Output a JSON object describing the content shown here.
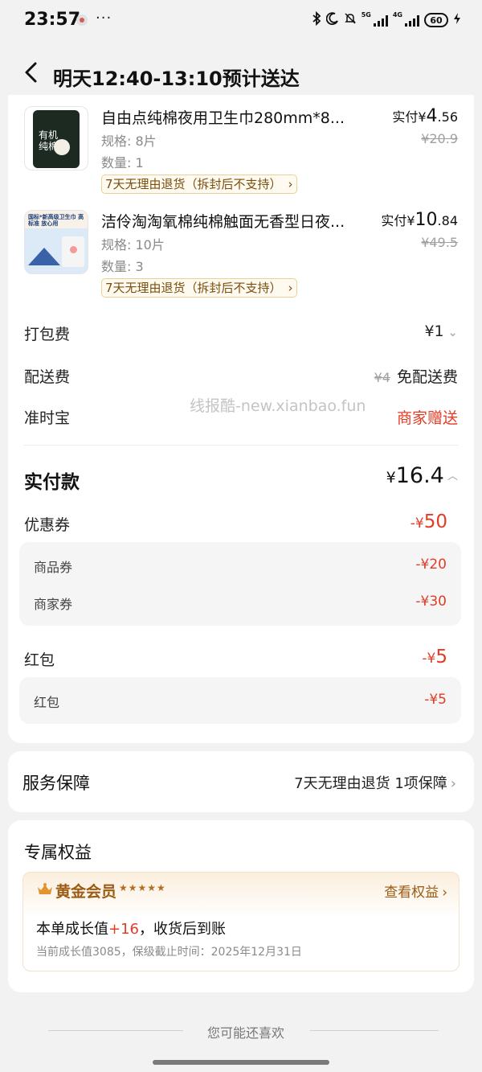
{
  "status_bar": {
    "time": "23:57",
    "more": "···",
    "network_label": "5G",
    "network_label2": "4G",
    "battery": "60"
  },
  "nav": {
    "title": "明天12:40-13:10预计送达"
  },
  "products": [
    {
      "thumb_text": "有机纯棉",
      "title": "自由点纯棉夜用卫生巾280mm*8...",
      "spec": "规格: 8片",
      "qty": "数量: 1",
      "return_tag": "7天无理由退货（拆封后不支持）",
      "paid_label": "实付",
      "paid_yen": "¥",
      "paid_int": "4",
      "paid_dec": ".56",
      "orig_price": "¥20.9"
    },
    {
      "thumb_text": "国标*新高级卫生巾 高标准 放心用",
      "title": "洁伶淘淘氧棉纯棉触面无香型日夜...",
      "spec": "规格: 10片",
      "qty": "数量: 3",
      "return_tag": "7天无理由退货（拆封后不支持）",
      "paid_label": "实付",
      "paid_yen": "¥",
      "paid_int": "10",
      "paid_dec": ".84",
      "orig_price": "¥49.5"
    }
  ],
  "fees": {
    "packing_label": "打包费",
    "packing_value": "¥1",
    "delivery_label": "配送费",
    "delivery_orig": "¥4",
    "delivery_value": "免配送费",
    "ontime_label": "准时宝",
    "ontime_value": "商家赠送"
  },
  "watermark": "线报酷-new.xianbao.fun",
  "total": {
    "label": "实付款",
    "yen": "¥",
    "value": "16.4"
  },
  "coupons": {
    "label": "优惠券",
    "yen": "-¥",
    "value": "50",
    "items": [
      {
        "label": "商品券",
        "value": "-¥20"
      },
      {
        "label": "商家券",
        "value": "-¥30"
      }
    ]
  },
  "red_packet": {
    "label": "红包",
    "yen": "-¥",
    "value": "5",
    "items": [
      {
        "label": "红包",
        "value": "-¥5"
      }
    ]
  },
  "service": {
    "label": "服务保障",
    "value": "7天无理由退货 1项保障"
  },
  "benefits": {
    "title": "专属权益",
    "vip_name": "黄金会员",
    "vip_stars": "★★★★★",
    "link": "查看权益",
    "main_prefix": "本单成长值",
    "main_plus": "+16",
    "main_suffix": "，收货后到账",
    "sub": "当前成长值3085，保级截止时间：2025年12月31日"
  },
  "recommend": {
    "label": "您可能还喜欢"
  },
  "colors": {
    "accent_red": "#e33c25",
    "gold": "#9c5b12",
    "tag_border": "#e9cf98"
  }
}
